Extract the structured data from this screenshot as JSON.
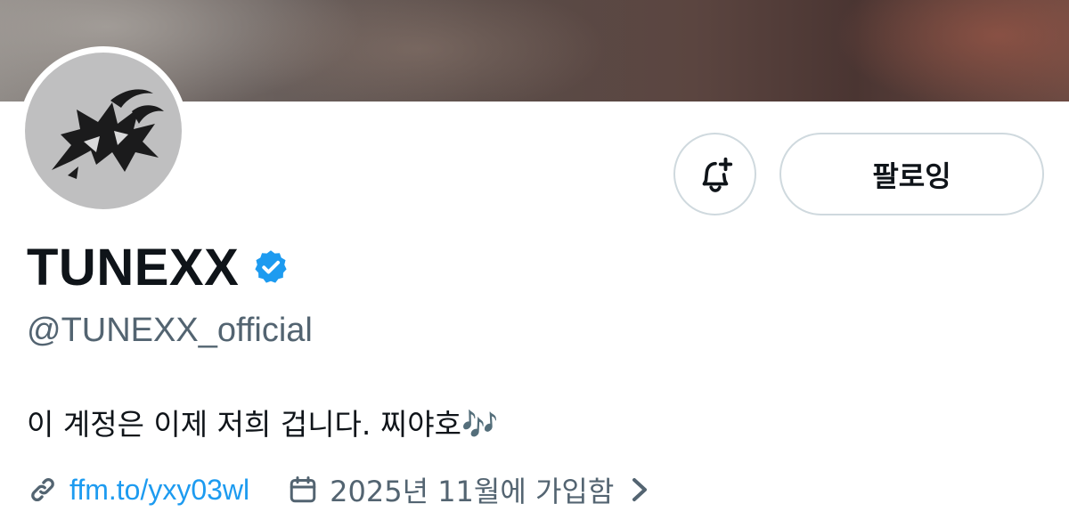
{
  "profile": {
    "display_name": "TUNEXX",
    "handle": "@TUNEXX_official",
    "bio": "이 계정은 이제 저희 겁니다. 찌야호🎶",
    "website": "ffm.to/yxy03wl",
    "joined": "2025년 11월에 가입함",
    "verified": true
  },
  "actions": {
    "follow_label": "팔로잉",
    "bell_icon": "bell-plus-icon"
  },
  "icons": {
    "verified": "verified-badge-icon",
    "link": "link-icon",
    "calendar": "calendar-icon",
    "chevron": "chevron-right-icon"
  },
  "colors": {
    "link": "#1d9bf0",
    "verified": "#1d9bf0",
    "secondary_text": "#536471",
    "button_border": "#cfd9de"
  }
}
